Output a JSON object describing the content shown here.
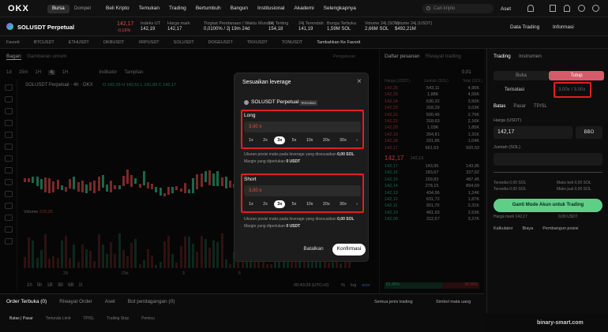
{
  "brand": "OKX",
  "header": {
    "mode_tabs": [
      "Bursa",
      "Dompet"
    ],
    "nav": [
      "Beli Kripto",
      "Temukan",
      "Trading",
      "Bertumbuh",
      "Bangun",
      "Institusional",
      "Akademi",
      "Selengkapnya"
    ],
    "search_placeholder": "Cari kripto",
    "account": "Aset"
  },
  "ticker": {
    "symbol": "SOLUSDT Perpetual",
    "price": "142,17",
    "change": "-0,16%",
    "stats": [
      {
        "label": "Indeks UT",
        "value": "142,19"
      },
      {
        "label": "Harga mark",
        "value": "142,17"
      },
      {
        "label": "Tingkat Pendanaan / Waktu Mundur",
        "value": "0,0100% / 2j 19m 24d"
      },
      {
        "label": "24j Terting",
        "value": "154,18"
      },
      {
        "label": "24j Terendah",
        "value": "141,19"
      },
      {
        "label": "Bunga Terbuka",
        "value": "1,59M SOL"
      },
      {
        "label": "Volume 24j (SOL)",
        "value": "2,66M SOL"
      },
      {
        "label": "Volume 24j (USDT)",
        "value": "$492,21M"
      }
    ],
    "right": [
      "Data Trading",
      "Informasi"
    ]
  },
  "favorites": [
    "Favorit",
    "BTCUSDT",
    "ETHUSDT",
    "OKBUSDT",
    "XRPUSDT",
    "SOLUSDT",
    "DOGEUSDT",
    "TRXUSDT",
    "TONUSDT",
    "Tambahkan Ke Favorit"
  ],
  "chart": {
    "tabs": [
      "Bagan",
      "Gambaran umum"
    ],
    "settings": "Pengaturan",
    "intervals": [
      "1d",
      "15m",
      "1H",
      "4j",
      "1H"
    ],
    "indikator": "Indikator",
    "tampilan": "Tampilan",
    "title": "SOLUSDT Perpetual · 4h · OKX",
    "ohlc": "O 142,26  H 142,61  L 141,89  C 142,17",
    "volume_label": "Volume",
    "volume_value": "229,26",
    "xlabels": [
      "29",
      "Okt",
      "3",
      "5"
    ],
    "ranges": [
      "1h",
      "5h",
      "1B",
      "3B",
      "6B",
      "1t"
    ],
    "time": "00:43:29 (UTC+0)",
    "pct": "%",
    "log": "log",
    "auto": "auto"
  },
  "orderbook": {
    "tabs": [
      "Daftar pesanan",
      "Riwayat trading"
    ],
    "precision": "0,01",
    "headers": [
      "Harga (USDT)",
      "Jumlah (SOL)",
      "Total (SOL)"
    ],
    "asks": [
      [
        "142,26",
        "543,11",
        "4,90K"
      ],
      [
        "142,25",
        "1,88K",
        "4,55K"
      ],
      [
        "142,24",
        "630,32",
        "3,50K"
      ],
      [
        "142,23",
        "318,29",
        "3,03K"
      ],
      [
        "142,22",
        "500,46",
        "2,70K"
      ],
      [
        "142,21",
        "318,63",
        "2,16K"
      ],
      [
        "142,20",
        "1,03K",
        "1,85K"
      ],
      [
        "142,19",
        "264,81",
        "1,31K"
      ],
      [
        "142,18",
        "201,85",
        "1,04K"
      ],
      [
        "142,17",
        "661,53",
        "920,53"
      ]
    ],
    "mid": "142,17",
    "mid_mark": "142,19",
    "bids": [
      [
        "142,17",
        "143,95",
        "143,95"
      ],
      [
        "142,16",
        "183,67",
        "327,62"
      ],
      [
        "142,15",
        "159,83",
        "487,45"
      ],
      [
        "142,14",
        "278,15",
        "894,69"
      ],
      [
        "142,13",
        "434,96",
        "1,24K"
      ],
      [
        "142,12",
        "631,72",
        "1,87K"
      ],
      [
        "142,11",
        "301,70",
        "2,31K"
      ],
      [
        "142,10",
        "481,93",
        "2,63K"
      ],
      [
        "142,09",
        "312,57",
        "3,27K"
      ]
    ],
    "buy_pct": "61,45%",
    "sell_pct": "38,55%"
  },
  "trade": {
    "tabs": [
      "Trading",
      "Instrumen"
    ],
    "side_tabs": [
      "Buka",
      "Tutup"
    ],
    "margin": "Terisolasi",
    "leverage_btn": "3,00x / 3,00x",
    "order_types": [
      "Batas",
      "Pasar",
      "TP/SL"
    ],
    "price_label": "Harga (USDT)",
    "price": "142,17",
    "bbo": "BBO",
    "amount_label": "Jumlah (SOL)",
    "avail_label": "Tersedia",
    "avail": [
      "0,00 SOL",
      "0,00 SOL",
      "0,00 USDT"
    ],
    "max": [
      "Maks beli 0,00 SOL",
      "Maks jual 0,00 SOL"
    ],
    "cost": "0,00 USDT",
    "cta": "Ganti Mode Akun untuk Trading",
    "liq": "Harga mark 142,17",
    "tools": [
      "Kalkulator",
      "Biaya",
      "Pembangun posisi"
    ]
  },
  "bottom": {
    "tabs": [
      "Order Terbuka (0)",
      "Riwayat Order",
      "Aset",
      "Bot perdagangan (0)"
    ],
    "filters": [
      "Semua jenis trading",
      "Simbol mata uang"
    ],
    "subtabs": [
      "Batas | Pasar",
      "Tertunda Limit",
      "TP/SL",
      "Trailing Stop",
      "Pemicu"
    ]
  },
  "modal": {
    "title": "Sesuaikan leverage",
    "instrument": "SOLUSDT Perpetual",
    "badge": "Terisolasi",
    "long": {
      "label": "Long",
      "value": "3,00 x",
      "presets": [
        "1x",
        "2x",
        "3x",
        "5x",
        "10x",
        "20x",
        "30x"
      ],
      "selected": "3x",
      "max_pos_label": "Ukuran posisi maks pada leverage yang disesuaikan",
      "max_pos": "0,00 SOL",
      "margin_label": "Margin yang diperlukan",
      "margin": "0 USDT"
    },
    "short": {
      "label": "Short",
      "value": "3,00 x",
      "presets": [
        "1x",
        "2x",
        "3x",
        "5x",
        "10x",
        "20x",
        "30x"
      ],
      "selected": "3x",
      "max_pos_label": "Ukuran posisi maks pada leverage yang disesuaikan",
      "max_pos": "0,00 SOL",
      "margin_label": "Margin yang diperlukan",
      "margin": "0 USDT"
    },
    "cancel": "Batalkan",
    "confirm": "Konfirmasi"
  },
  "watermark": "binary-smart.com",
  "colors": {
    "up": "#2ebd85",
    "down": "#e0494b",
    "accent_red": "#e0201e",
    "bg": "#0b0b0b"
  }
}
